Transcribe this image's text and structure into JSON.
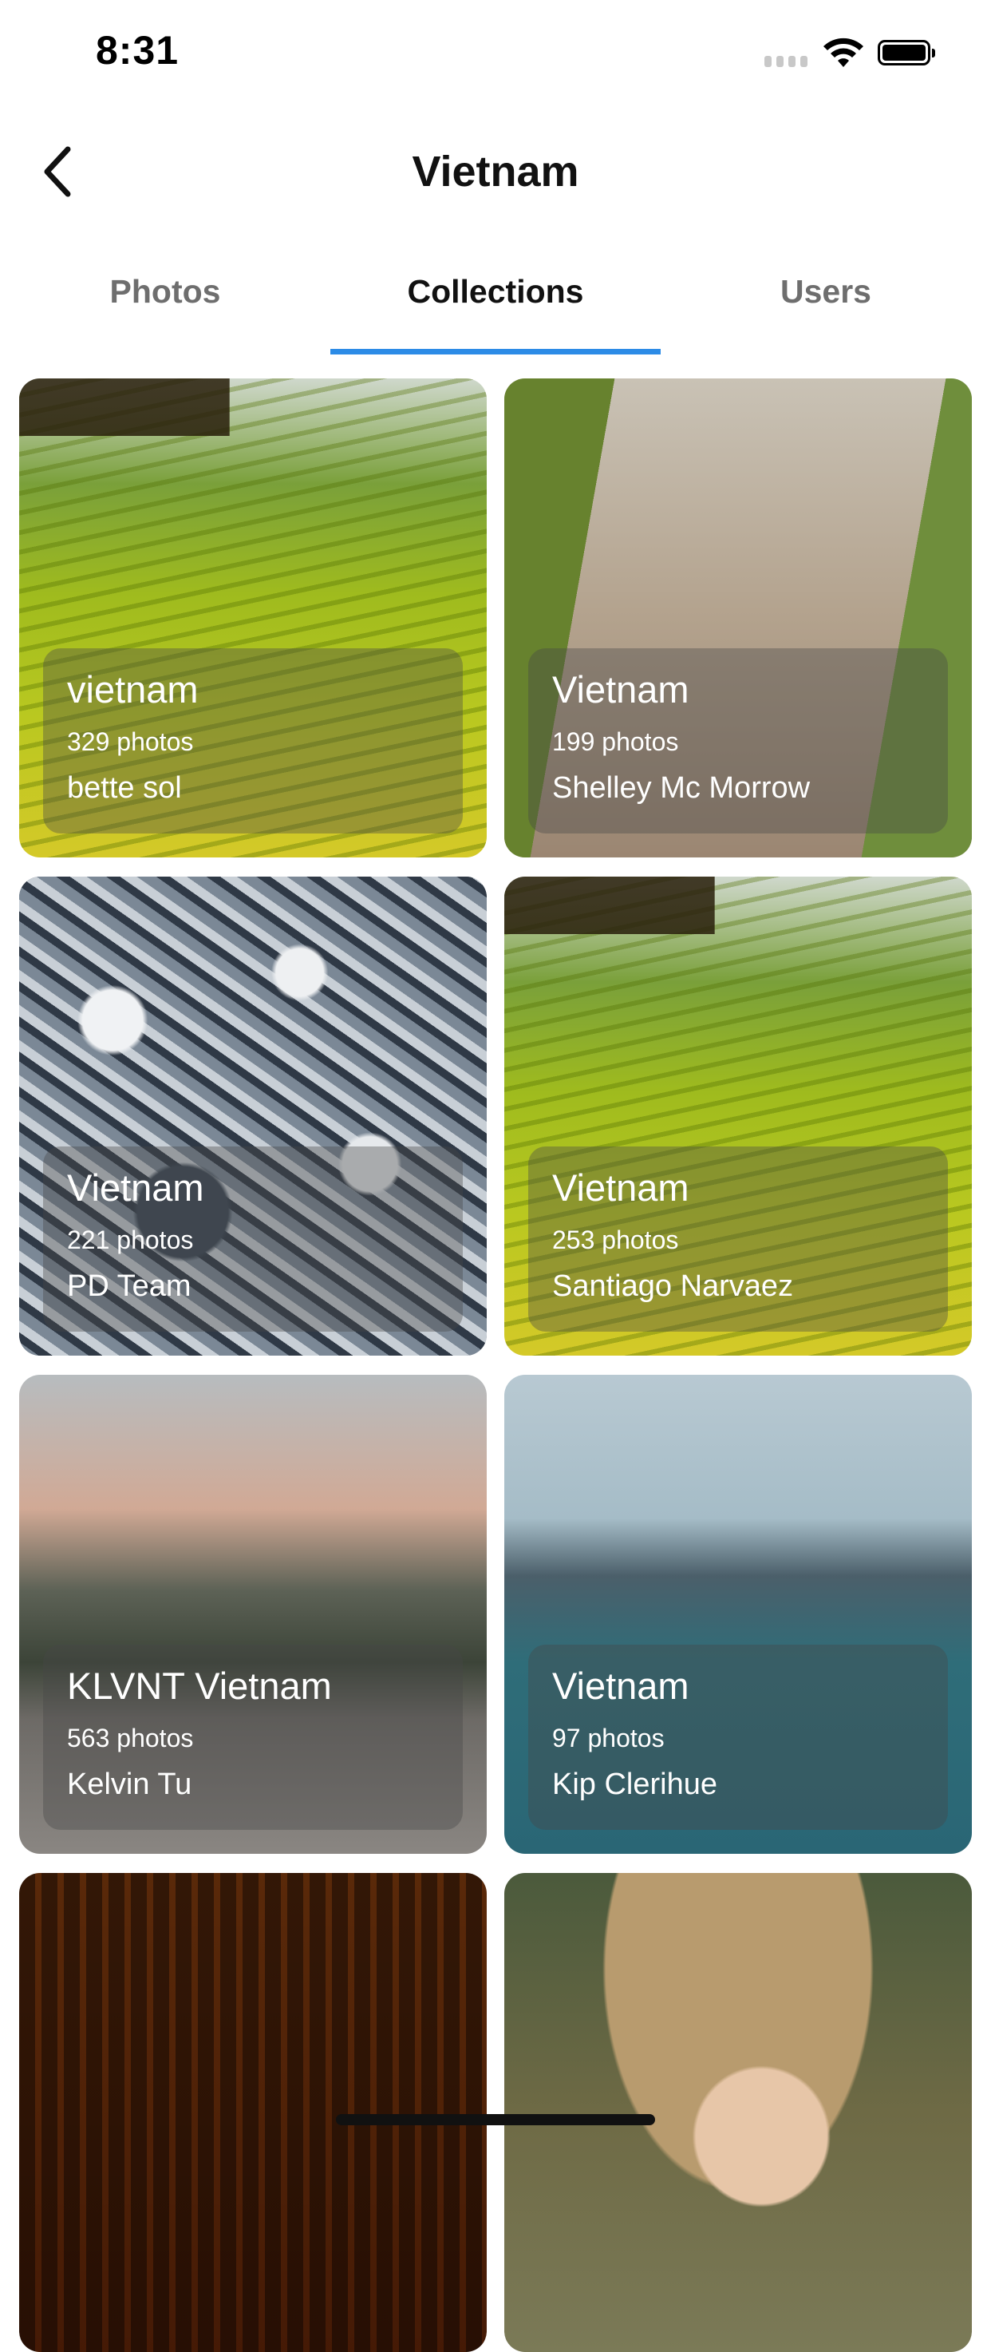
{
  "status_bar": {
    "time": "8:31"
  },
  "header": {
    "title": "Vietnam",
    "back_icon": "chevron-left-icon"
  },
  "tabs": [
    {
      "label": "Photos",
      "active": false
    },
    {
      "label": "Collections",
      "active": true
    },
    {
      "label": "Users",
      "active": false
    }
  ],
  "colors": {
    "tab_indicator": "#2c8be6",
    "active_tab_text": "#111111",
    "inactive_tab_text": "#6e6e6e"
  },
  "collections": [
    {
      "title": "vietnam",
      "count": "329 photos",
      "user": "bette sol"
    },
    {
      "title": "Vietnam",
      "count": "199 photos",
      "user": "Shelley Mc Morrow"
    },
    {
      "title": "Vietnam",
      "count": "221 photos",
      "user": "PD Team"
    },
    {
      "title": "Vietnam",
      "count": "253 photos",
      "user": "Santiago Narvaez"
    },
    {
      "title": "KLVNT Vietnam",
      "count": "563 photos",
      "user": "Kelvin Tu"
    },
    {
      "title": "Vietnam",
      "count": "97 photos",
      "user": "Kip Clerihue"
    },
    {
      "title": "",
      "count": "",
      "user": ""
    },
    {
      "title": "",
      "count": "",
      "user": ""
    }
  ]
}
